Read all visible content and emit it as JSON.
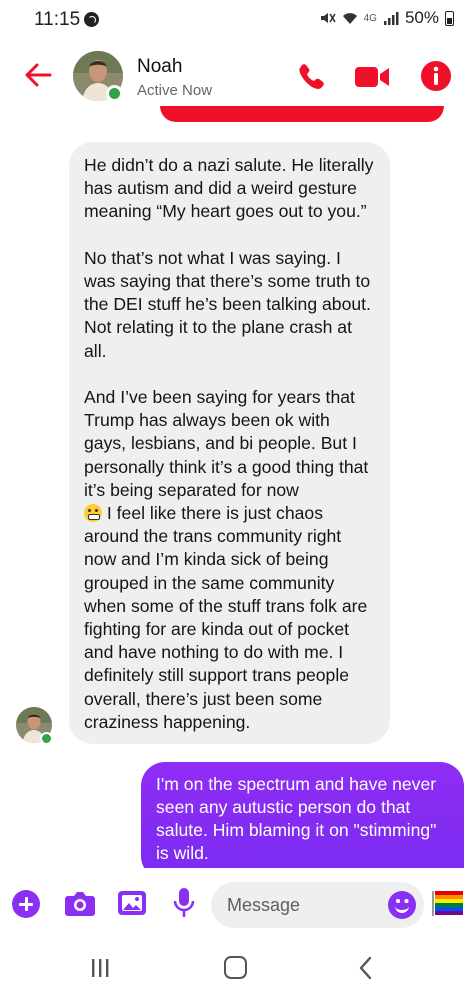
{
  "status_bar": {
    "time": "11:15",
    "network": "4G",
    "battery": "50%"
  },
  "header": {
    "contact_name": "Noah",
    "contact_status": "Active Now"
  },
  "messages": {
    "incoming_para1": "He didn’t do a nazi salute. He literally has autism and did a weird gesture meaning “My heart goes out to you.”",
    "incoming_para2": "No that’s not what I was saying. I was saying that there’s some truth to the DEI stuff he’s been talking about. Not relating it to the plane crash at all.",
    "incoming_para3a": "And I’ve been saying for years that Trump has always been ok with gays, lesbians, and bi people. But I personally think it’s a good thing that it’s being separated for now",
    "incoming_para3b": " I feel like there is just chaos around the trans community right now and I’m kinda sick of being grouped in the same community when some of the stuff trans folk are fighting for are kinda out of pocket and have nothing to do with me. I definitely still support trans people overall, there’s just been some craziness happening.",
    "outgoing": "I'm on the spectrum and have never seen any autustic person do that salute. Him blaming it on \"stimming\" is wild."
  },
  "composer": {
    "placeholder": "Message"
  },
  "colors": {
    "accent_red": "#f0102a",
    "outgoing_purple": "#8a30f4",
    "presence_green": "#31a24c",
    "incoming_gray": "#efefef"
  },
  "icons": {
    "back": "back-arrow-icon",
    "call": "phone-icon",
    "video": "video-camera-icon",
    "info": "info-icon",
    "plus": "plus-icon",
    "camera": "camera-icon",
    "gallery": "image-icon",
    "mic": "microphone-icon",
    "emoji": "smiley-icon",
    "flag": "rainbow-flag-icon"
  }
}
